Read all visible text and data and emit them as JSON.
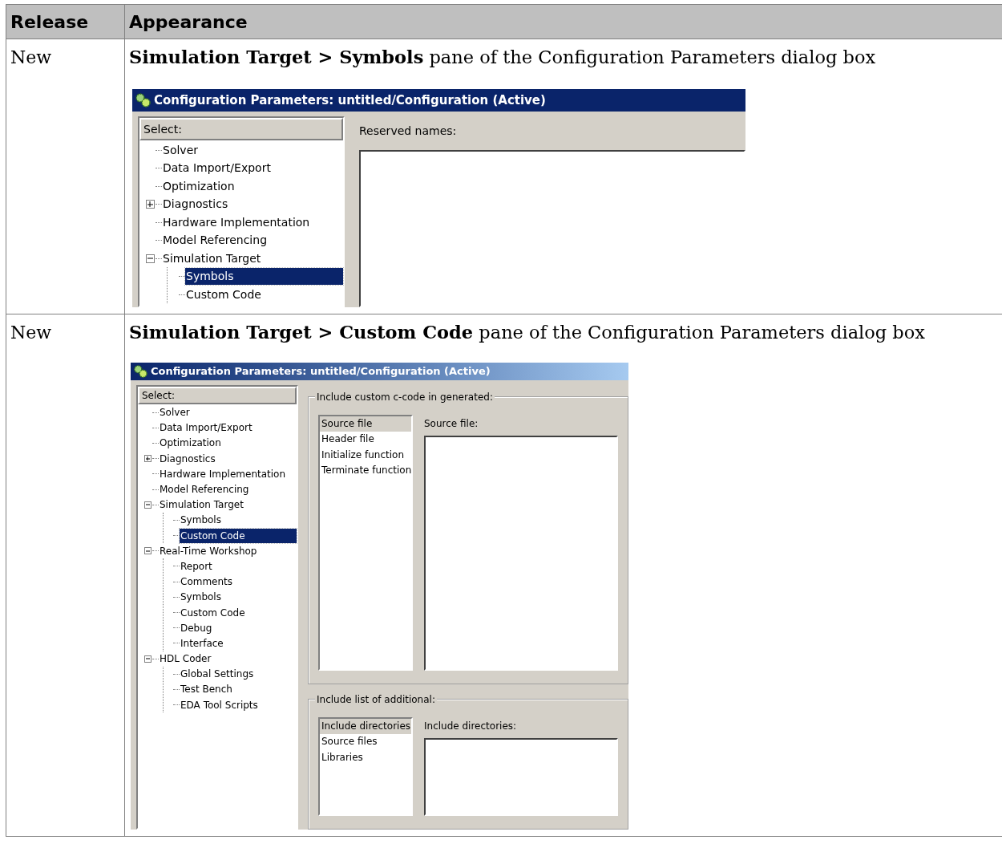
{
  "table": {
    "columns": [
      "Release",
      "Appearance"
    ],
    "rows": [
      {
        "release": "New",
        "caption": "**Simulation Target > Symbols** pane of the Configuration Parameters dialog box",
        "dialog": {
          "title": "Configuration Parameters: untitled/Configuration (Active)",
          "select_label": "Select:",
          "tree": [
            {
              "label": "Solver",
              "selected": false
            },
            {
              "label": "Data Import/Export",
              "selected": false
            },
            {
              "label": "Optimization",
              "selected": false
            },
            {
              "label": "Diagnostics",
              "selected": false,
              "expanded": false
            },
            {
              "label": "Hardware Implementation",
              "selected": false
            },
            {
              "label": "Model Referencing",
              "selected": false
            },
            {
              "label": "Simulation Target",
              "selected": false,
              "expanded": true,
              "children": [
                {
                  "label": "Symbols",
                  "selected": true
                },
                {
                  "label": "Custom Code",
                  "selected": false
                }
              ]
            }
          ],
          "panel": {
            "kind": "field",
            "label": "Reserved names:"
          }
        }
      },
      {
        "release": "New",
        "caption": "**Simulation Target > Custom Code** pane of the Configuration Parameters dialog box",
        "dialog": {
          "title": "Configuration Parameters: untitled/Configuration (Active)",
          "select_label": "Select:",
          "tree": [
            {
              "label": "Solver",
              "selected": false
            },
            {
              "label": "Data Import/Export",
              "selected": false
            },
            {
              "label": "Optimization",
              "selected": false
            },
            {
              "label": "Diagnostics",
              "selected": false,
              "expanded": false
            },
            {
              "label": "Hardware Implementation",
              "selected": false
            },
            {
              "label": "Model Referencing",
              "selected": false
            },
            {
              "label": "Simulation Target",
              "selected": false,
              "expanded": true,
              "children": [
                {
                  "label": "Symbols",
                  "selected": false
                },
                {
                  "label": "Custom Code",
                  "selected": true
                }
              ]
            },
            {
              "label": "Real-Time Workshop",
              "selected": false,
              "expanded": true,
              "children": [
                {
                  "label": "Report",
                  "selected": false
                },
                {
                  "label": "Comments",
                  "selected": false
                },
                {
                  "label": "Symbols",
                  "selected": false
                },
                {
                  "label": "Custom Code",
                  "selected": false
                },
                {
                  "label": "Debug",
                  "selected": false
                },
                {
                  "label": "Interface",
                  "selected": false
                }
              ]
            },
            {
              "label": "HDL Coder",
              "selected": false,
              "expanded": true,
              "children": [
                {
                  "label": "Global Settings",
                  "selected": false
                },
                {
                  "label": "Test Bench",
                  "selected": false
                },
                {
                  "label": "EDA Tool Scripts",
                  "selected": false
                }
              ]
            }
          ],
          "panel": {
            "kind": "groups",
            "groups": [
              {
                "legend": "Include custom c-code in generated:",
                "items": [
                  {
                    "label": "Source file",
                    "selected": true
                  },
                  {
                    "label": "Header file",
                    "selected": false
                  },
                  {
                    "label": "Initialize function",
                    "selected": false
                  },
                  {
                    "label": "Terminate function",
                    "selected": false
                  }
                ],
                "field_label": "Source file:"
              },
              {
                "legend": "Include list of additional:",
                "items": [
                  {
                    "label": "Include directories",
                    "selected": true
                  },
                  {
                    "label": "Source files",
                    "selected": false
                  },
                  {
                    "label": "Libraries",
                    "selected": false
                  }
                ],
                "field_label": "Include directories:"
              }
            ]
          }
        }
      }
    ]
  }
}
